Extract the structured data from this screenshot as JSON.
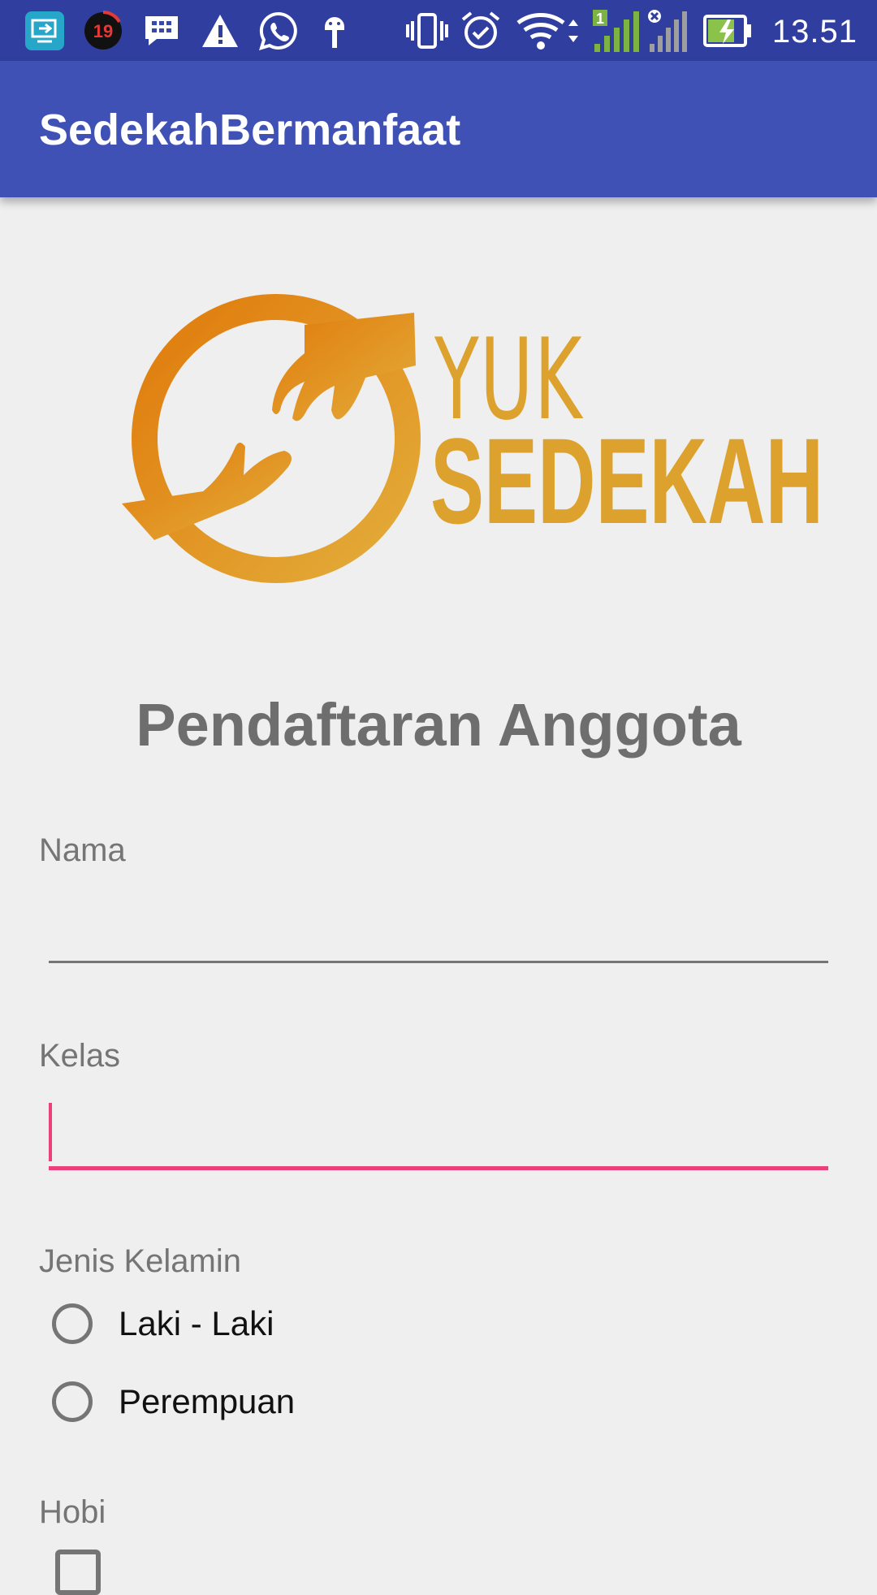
{
  "status_bar": {
    "notification_count": "19",
    "time": "13.51",
    "sim_label": "1",
    "icons": [
      "screen-mirror-icon",
      "notification-badge-icon",
      "bbm-icon",
      "warning-icon",
      "whatsapp-icon",
      "android-debug-icon",
      "vibrate-icon",
      "alarm-icon",
      "wifi-icon",
      "signal-sim1-icon",
      "signal-sim2-icon",
      "battery-charging-icon"
    ]
  },
  "app_bar": {
    "title": "SedekahBermanfaat"
  },
  "logo": {
    "line1": "YUK",
    "line2": "SEDEKAH",
    "color": "#dca22d"
  },
  "form": {
    "title": "Pendaftaran Anggota",
    "nama": {
      "label": "Nama",
      "value": ""
    },
    "kelas": {
      "label": "Kelas",
      "value": ""
    },
    "jenis_kelamin": {
      "label": "Jenis Kelamin",
      "options": [
        "Laki - Laki",
        "Perempuan"
      ]
    },
    "hobi": {
      "label": "Hobi"
    }
  },
  "colors": {
    "primary": "#3f51b5",
    "primary_dark": "#303f9f",
    "accent": "#ec407a"
  }
}
